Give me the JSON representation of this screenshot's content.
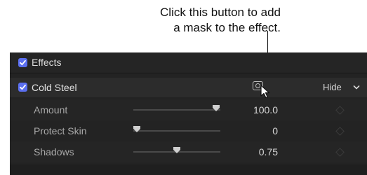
{
  "callout": {
    "line1": "Click this button to add",
    "line2": "a mask to the effect."
  },
  "effects": {
    "header_label": "Effects",
    "header_checked": true
  },
  "effect": {
    "name": "Cold Steel",
    "checked": true,
    "hide_label": "Hide",
    "mask_button_icon": "mask-circle-icon",
    "dropdown_icon": "chevron-down-icon"
  },
  "parameters": [
    {
      "label": "Amount",
      "value": "100.0",
      "level": 1.0
    },
    {
      "label": "Protect Skin",
      "value": "0",
      "level": 0.0
    },
    {
      "label": "Shadows",
      "value": "0.75",
      "level": 0.5
    }
  ],
  "colors": {
    "accent_checkbox": "#5b6ff0",
    "panel_background": "#232323",
    "effect_row_background": "#2c2c2c"
  }
}
